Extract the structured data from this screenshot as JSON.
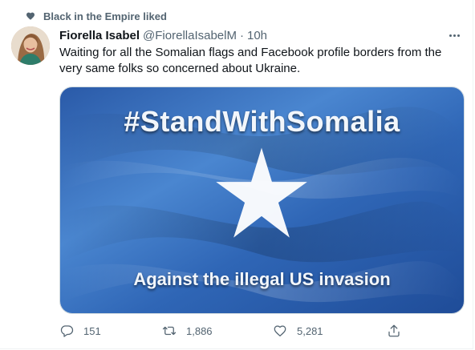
{
  "social_context": {
    "text": "Black in the Empire liked"
  },
  "author": {
    "display_name": "Fiorella Isabel",
    "handle": "@FiorellaIsabelM",
    "separator": "·",
    "time": "10h"
  },
  "tweet": {
    "text": "Waiting for all the Somalian flags and Facebook profile borders from the very same folks so concerned about Ukraine."
  },
  "media": {
    "headline": "#StandWithSomalia",
    "subline": "Against the illegal US invasion",
    "flag_color": "#3d78c6",
    "star_color": "#ffffff"
  },
  "actions": {
    "reply_count": "151",
    "retweet_count": "1,886",
    "like_count": "5,281"
  },
  "icons": [
    "heart-icon",
    "more-icon",
    "reply-icon",
    "retweet-icon",
    "like-icon",
    "share-icon"
  ]
}
